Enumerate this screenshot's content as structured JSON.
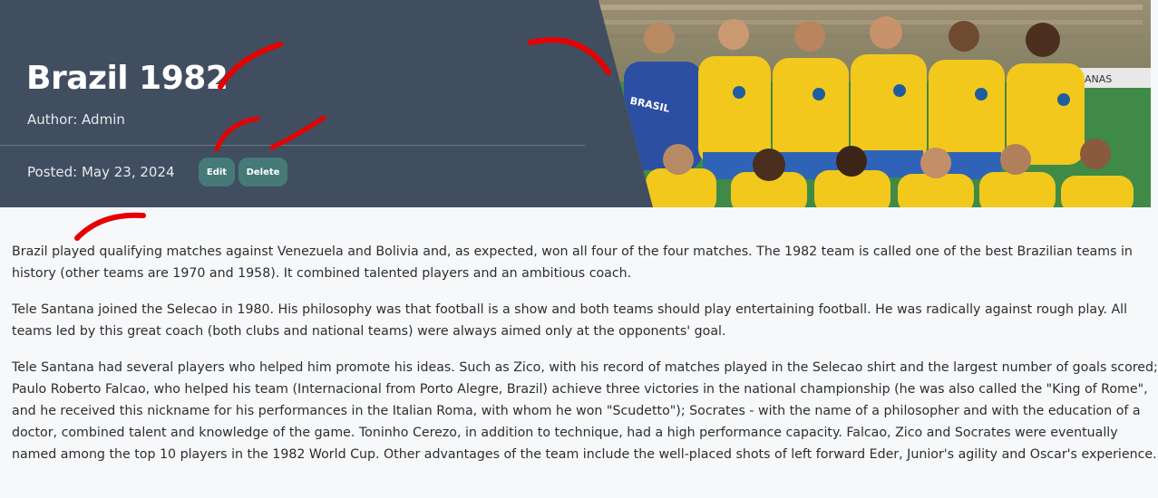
{
  "post": {
    "title": "Brazil 1982",
    "author": "Author: Admin",
    "posted": "Posted: May 23, 2024",
    "edit_label": "Edit",
    "delete_label": "Delete",
    "image_shirt_text": "BRASIL",
    "image_board_text": "ANAS",
    "paragraphs": [
      "Brazil played qualifying matches against Venezuela and Bolivia and, as expected, won all four of the four matches. The 1982 team is called one of the best Brazilian teams in history (other teams are 1970 and 1958). It combined talented players and an ambitious coach.",
      "Tele Santana joined the Selecao in 1980. His philosophy was that football is a show and both teams should play entertaining football. He was radically against rough play. All teams led by this great coach (both clubs and national teams) were always aimed only at the opponents' goal.",
      "Tele Santana had several players who helped him promote his ideas. Such as Zico, with his record of matches played in the Selecao shirt and the largest number of goals scored; Paulo Roberto Falcao, who helped his team (Internacional from Porto Alegre, Brazil) achieve three victories in the national championship (he was also called the \"King of Rome\", and he received this nickname for his performances in the Italian Roma, with whom he won \"Scudetto\"); Socrates - with the name of a philosopher and with the education of a doctor, combined talent and knowledge of the game. Toninho Cerezo, in addition to technique, had a high performance capacity. Falcao, Zico and Socrates were eventually named among the top 10 players in the 1982 World Cup. Other advantages of the team include the well-placed shots of left forward Eder, Junior's agility and Oscar's experience."
    ]
  },
  "colors": {
    "hero_bg": "#414e60",
    "button_bg": "#457a78",
    "annotation": "#e60000",
    "jersey_yellow": "#f2c81c",
    "shorts_blue": "#2f63b8"
  }
}
